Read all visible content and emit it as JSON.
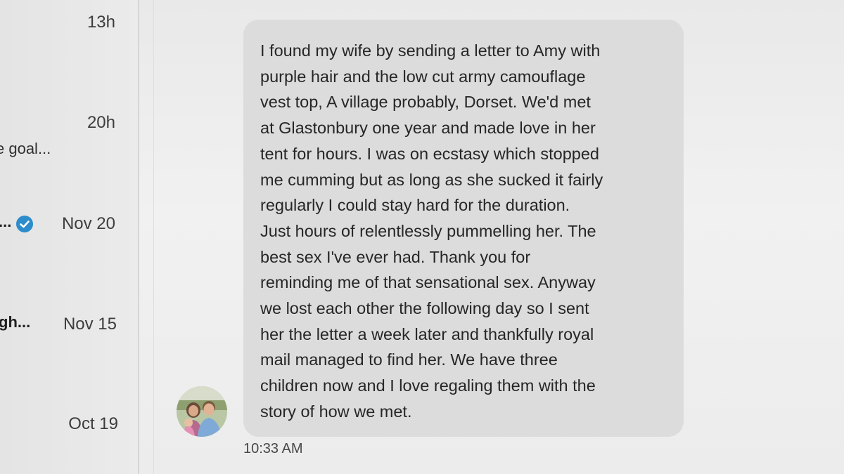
{
  "conversation_list": {
    "items": [
      {
        "time": "13h",
        "preview": ""
      },
      {
        "time": "20h",
        "preview": "e goal..."
      },
      {
        "time": "Nov 20",
        "preview": "...",
        "verified": true
      },
      {
        "time": "Nov 15",
        "preview": "gh..."
      },
      {
        "time": "Oct 19",
        "preview": ""
      }
    ]
  },
  "message": {
    "text": "I found my wife by sending a letter to Amy with\npurple hair and the low cut army camouflage\nvest top, A village probably, Dorset. We'd met\nat Glastonbury one year and made love in her\ntent for hours. I was on ecstasy which stopped\nme cumming but as long as she sucked it fairly\nregularly I could stay hard for the duration.\nJust hours of relentlessly pummelling her. The\nbest sex I've ever had. Thank you for\nreminding me of that sensational sex. Anyway\nwe lost each other the following day so I sent\nher the letter a week later and thankfully royal\nmail managed to find her. We have three\nchildren now and I love regaling them with the\nstory of how we met.",
    "timestamp": "10:33 AM"
  },
  "colors": {
    "bubble": "#dcdcdc",
    "verified_badge": "#2d8ccc",
    "background": "#ececec"
  },
  "icons": {
    "verified": "verified-badge-icon",
    "avatar": "user-avatar-photo"
  }
}
